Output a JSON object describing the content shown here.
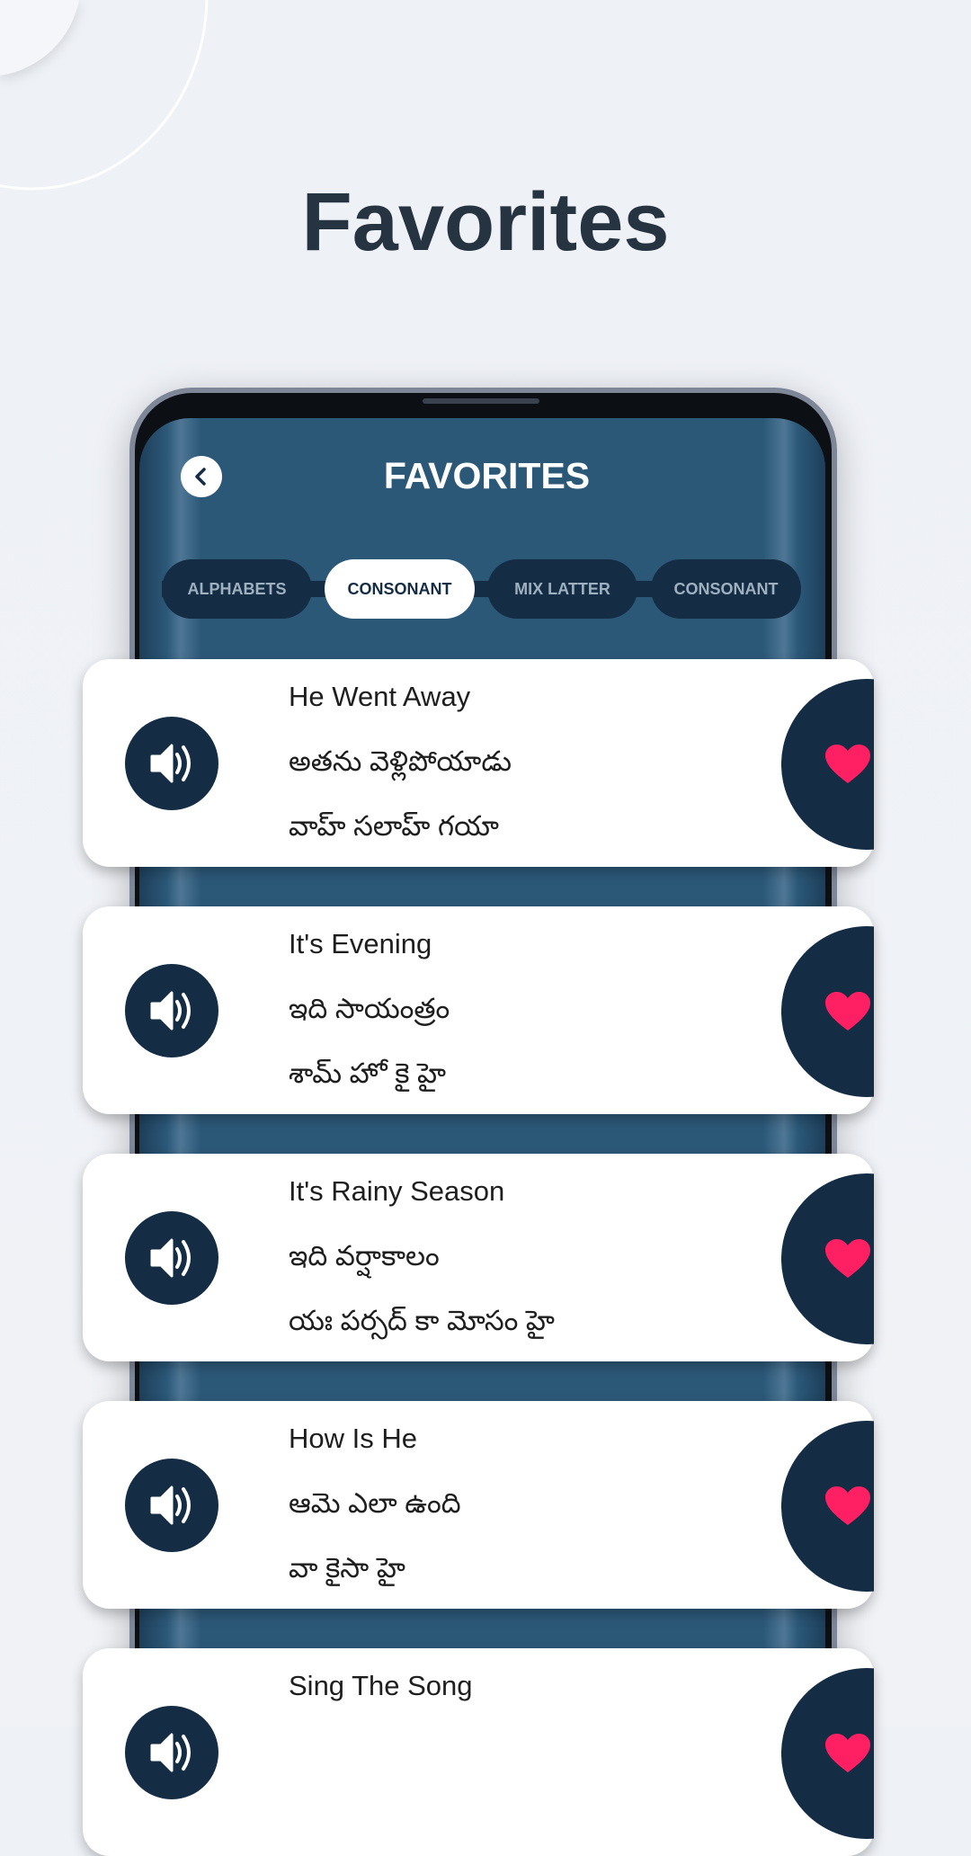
{
  "headline": "Favorites",
  "screen": {
    "title": "FAVORITES",
    "back_icon": "chevron-left-icon",
    "tabs": [
      {
        "label": "ALPHABETS",
        "active": false
      },
      {
        "label": "CONSONANT",
        "active": true
      },
      {
        "label": "MIX LATTER",
        "active": false
      },
      {
        "label": "CONSONANT",
        "active": false
      }
    ],
    "items": [
      {
        "english": "He Went Away",
        "telugu": "అతను వెళ్లిపోయాడు",
        "transliteration": "వాహ్ సలాహ్ గయా"
      },
      {
        "english": "It's Evening",
        "telugu": "ఇది సాయంత్రం",
        "transliteration": "శామ్ హో కై హై"
      },
      {
        "english": "It's Rainy Season",
        "telugu": "ఇది వర్షాకాలం",
        "transliteration": "యః పర్సద్ కా మోసం హై"
      },
      {
        "english": "How Is He",
        "telugu": "ఆమె ఎలా ఉంది",
        "transliteration": "వా కైసా హై"
      },
      {
        "english": "Sing The Song",
        "telugu": "",
        "transliteration": ""
      }
    ]
  },
  "colors": {
    "navy": "#142d45",
    "screen": "#2c5878",
    "heart": "#ff1f63",
    "background": "#eef1f6"
  }
}
